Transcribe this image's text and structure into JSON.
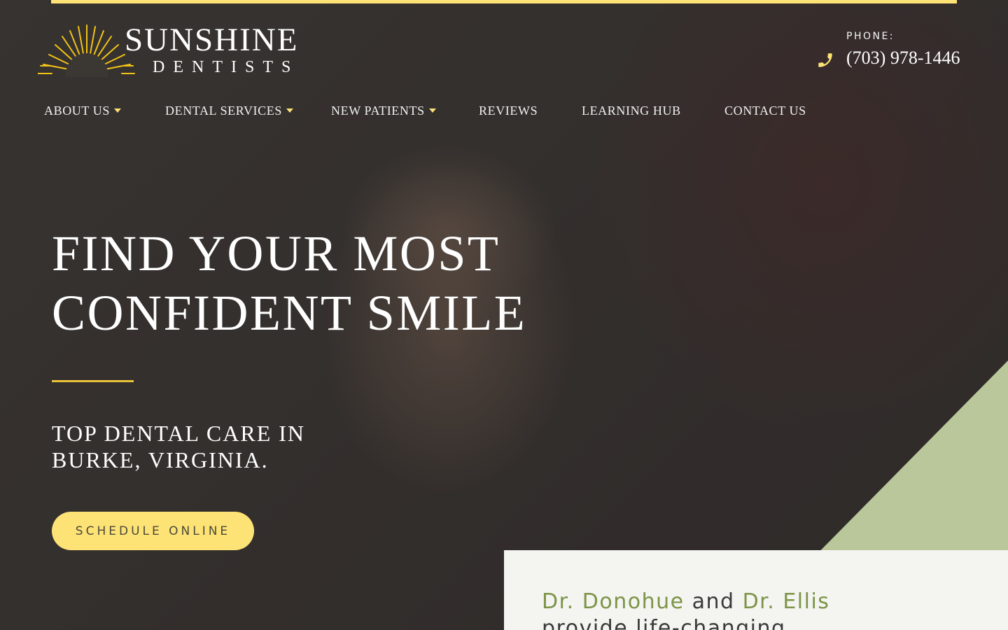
{
  "brand": {
    "name": "SUNSHINE",
    "tagline": "DENTISTS",
    "accent_color": "#fde275",
    "green_color": "#b9c79b"
  },
  "phone": {
    "label": "PHONE:",
    "number": "(703) 978-1446",
    "icon": "phone-icon"
  },
  "nav": {
    "items": [
      {
        "label": "ABOUT US",
        "has_dropdown": true
      },
      {
        "label": "DENTAL SERVICES",
        "has_dropdown": true
      },
      {
        "label": "NEW PATIENTS",
        "has_dropdown": true
      },
      {
        "label": "REVIEWS",
        "has_dropdown": false
      },
      {
        "label": "LEARNING HUB",
        "has_dropdown": false
      },
      {
        "label": "CONTACT US",
        "has_dropdown": false
      }
    ]
  },
  "hero": {
    "title_line1": "FIND YOUR MOST",
    "title_line2": "CONFIDENT SMILE",
    "subtitle_line1": "TOP DENTAL CARE IN",
    "subtitle_line2": "BURKE, VIRGINIA.",
    "cta_label": "SCHEDULE ONLINE"
  },
  "intro": {
    "doctor1": "Dr. Donohue",
    "conjunction": " and ",
    "doctor2": "Dr. Ellis",
    "text_rest": "provide life-changing"
  }
}
